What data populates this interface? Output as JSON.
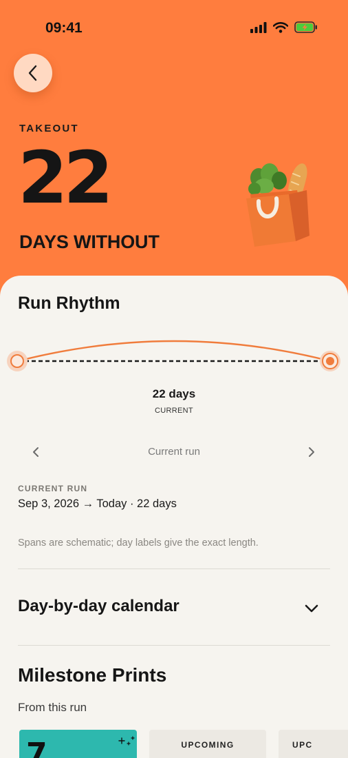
{
  "status_bar": {
    "time": "09:41"
  },
  "hero": {
    "category": "TAKEOUT",
    "count": "22",
    "caption": "DAYS WITHOUT",
    "illustration": "grocery-bag-illustration"
  },
  "run_rhythm": {
    "title": "Run Rhythm",
    "run_days": "22 days",
    "run_status": "CURRENT",
    "nav_label": "Current run",
    "current_run_label": "CURRENT RUN",
    "current_run_range": "Sep 3, 2026 → Today · 22 days",
    "note": "Spans are schematic; day labels give the exact length."
  },
  "calendar": {
    "title": "Day-by-day calendar",
    "expanded": false
  },
  "milestones": {
    "title": "Milestone Prints",
    "subtitle": "From this run",
    "cards": [
      {
        "label": "",
        "number": "7",
        "color": "#2DB8AE",
        "state": "earned"
      },
      {
        "label": "UPCOMING",
        "color": "#ECE9E3",
        "state": "upcoming"
      },
      {
        "label": "UPC",
        "color": "#ECE9E3",
        "state": "upcoming"
      }
    ]
  },
  "colors": {
    "accent": "#FF7D3E",
    "teal": "#2DB8AE",
    "battery": "#4CCB3C"
  }
}
